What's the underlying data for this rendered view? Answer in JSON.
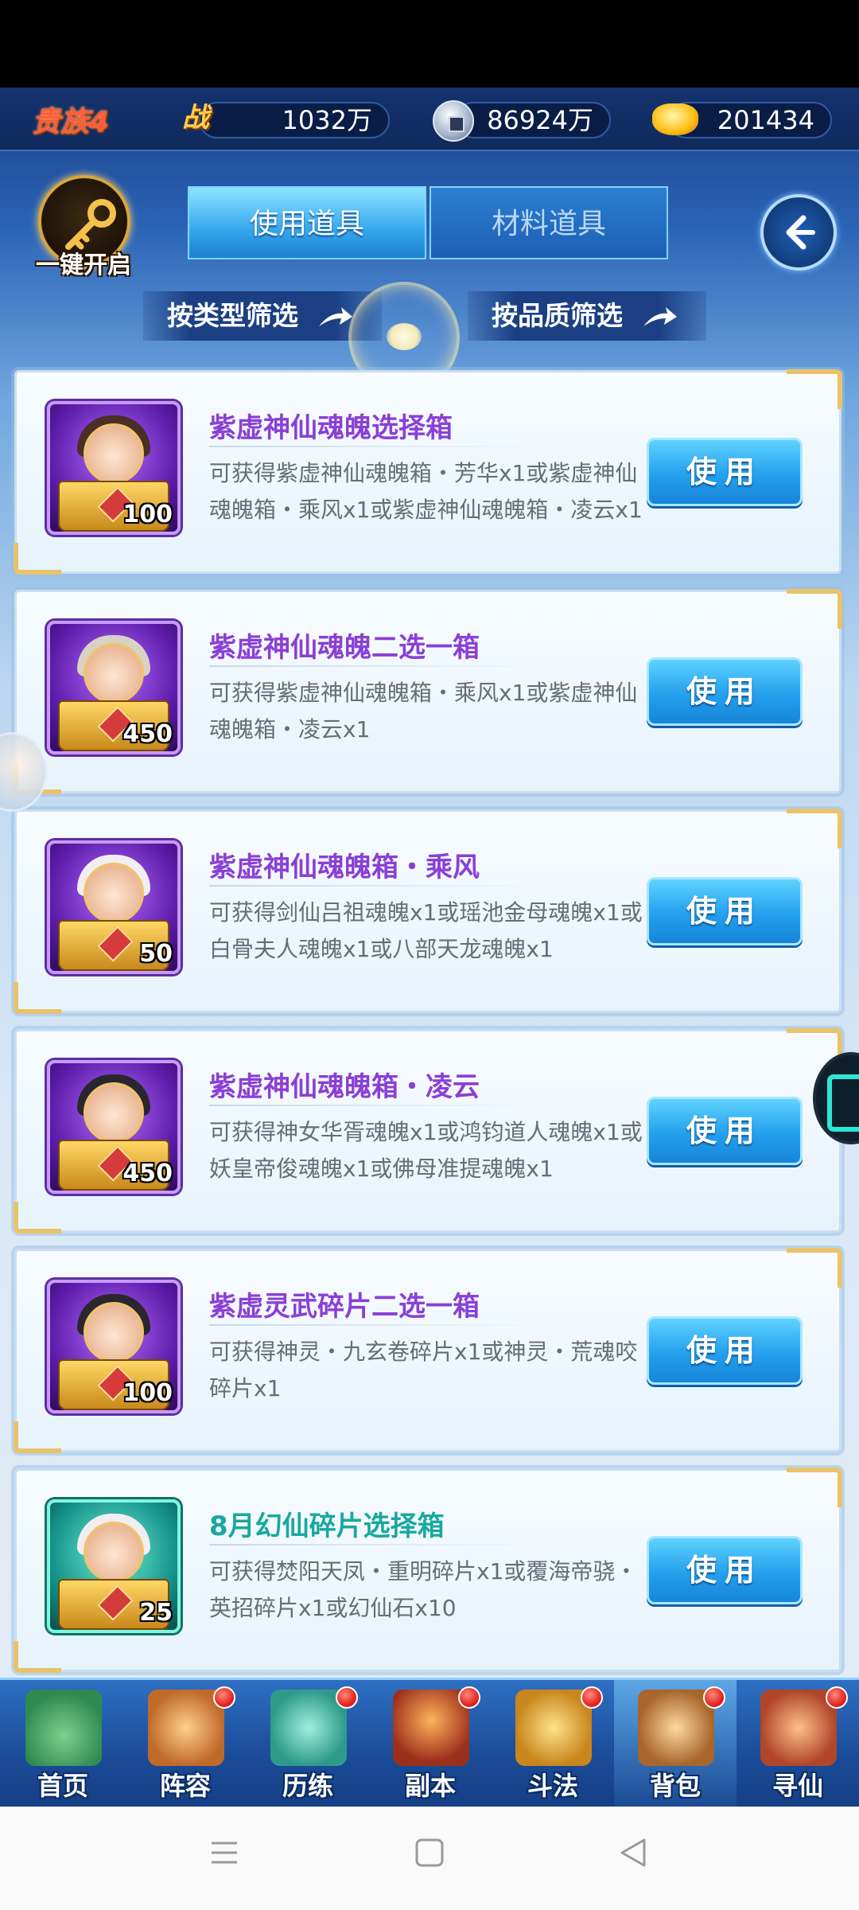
{
  "topbar": {
    "vip_label": "贵族4",
    "battle_icon_text": "战",
    "battle_power": "1032万",
    "silver": "86924万",
    "gold": "201434",
    "icons": [
      "battle-power-icon",
      "silver-coin-icon",
      "gold-ingot-icon"
    ]
  },
  "header": {
    "key_button_label": "一键开启",
    "tabs": [
      {
        "label": "使用道具",
        "active": true
      },
      {
        "label": "材料道具",
        "active": false
      }
    ],
    "filters": [
      {
        "label": "按类型筛选"
      },
      {
        "label": "按品质筛选"
      }
    ]
  },
  "items": [
    {
      "name": "紫虚神仙魂魄选择箱",
      "desc": "可获得紫虚神仙魂魄箱・芳华x1或紫虚神仙魂魄箱・乘风x1或紫虚神仙魂魄箱・凌云x1",
      "count": "100",
      "button": "使用",
      "rarity": "purple"
    },
    {
      "name": "紫虚神仙魂魄二选一箱",
      "desc": "可获得紫虚神仙魂魄箱・乘风x1或紫虚神仙魂魄箱・凌云x1",
      "count": "450",
      "button": "使用",
      "rarity": "purple"
    },
    {
      "name": "紫虚神仙魂魄箱・乘风",
      "desc": "可获得剑仙吕祖魂魄x1或瑶池金母魂魄x1或白骨夫人魂魄x1或八部天龙魂魄x1",
      "count": "50",
      "button": "使用",
      "rarity": "purple"
    },
    {
      "name": "紫虚神仙魂魄箱・凌云",
      "desc": "可获得神女华胥魂魄x1或鸿钧道人魂魄x1或妖皇帝俊魂魄x1或佛母准提魂魄x1",
      "count": "450",
      "button": "使用",
      "rarity": "purple"
    },
    {
      "name": "紫虚灵武碎片二选一箱",
      "desc": "可获得神灵・九玄卷碎片x1或神灵・荒魂咬碎片x1",
      "count": "100",
      "button": "使用",
      "rarity": "purple"
    },
    {
      "name": "8月幻仙碎片选择箱",
      "desc": "可获得焚阳天凤・重明碎片x1或覆海帝骁・英招碎片x1或幻仙石x10",
      "count": "25",
      "button": "使用",
      "rarity": "teal"
    }
  ],
  "bottom_nav": [
    {
      "label": "首页",
      "badge": false,
      "active": false,
      "color": "#4aa86a"
    },
    {
      "label": "阵容",
      "badge": true,
      "active": false,
      "color": "#d88a3a"
    },
    {
      "label": "历练",
      "badge": true,
      "active": false,
      "color": "#3fb3a0"
    },
    {
      "label": "副本",
      "badge": true,
      "active": false,
      "color": "#b8442c"
    },
    {
      "label": "斗法",
      "badge": true,
      "active": false,
      "color": "#e0a53a"
    },
    {
      "label": "背包",
      "badge": true,
      "active": true,
      "color": "#b87c3c"
    },
    {
      "label": "寻仙",
      "badge": true,
      "active": false,
      "color": "#c2563a"
    }
  ],
  "colors": {
    "purple_name": "#8b3fd6",
    "teal_name": "#19a89e",
    "button_blue": "#23a0ee",
    "badge_red": "#e01f1f"
  }
}
